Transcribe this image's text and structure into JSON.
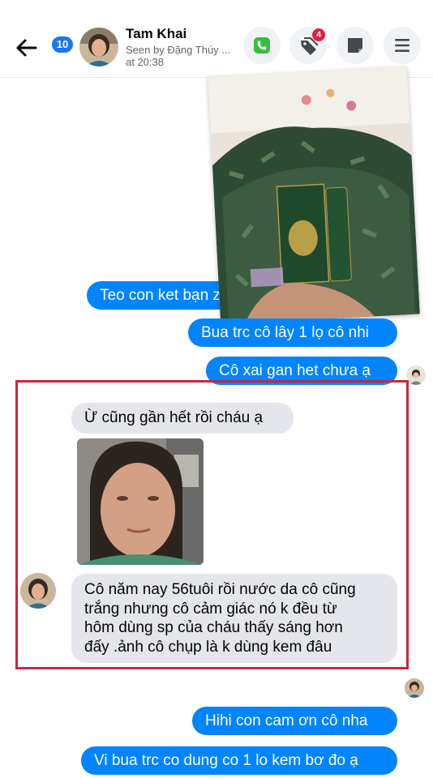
{
  "header": {
    "unread_count": "10",
    "contact_name": "Tam Khai",
    "seen_line1": "Seen by Đặng Thúy ...",
    "seen_line2": "at 20:38",
    "notification_count": "4"
  },
  "messages": [
    {
      "dir": "out",
      "text": "Teo con ket bạn zalo"
    },
    {
      "dir": "out",
      "text": "Bua trc cô lây 1 lọ cô nhi"
    },
    {
      "dir": "out",
      "text": "Cô xai gan het chưa ạ"
    },
    {
      "dir": "in",
      "text": "Ừ cũng gần hết rồi cháu ạ"
    },
    {
      "dir": "in",
      "lines": [
        "Cô năm nay 56tuôi rồi nước da cô cũng",
        "trắng nhưng cô cảm giác nó k đều từ",
        "hôm dùng sp của cháu thấy sáng hơn",
        "đấy .ảnh cô chụp là k dùng kem đâu"
      ]
    },
    {
      "dir": "out",
      "text": "Hihi con cam ơn cô nha"
    },
    {
      "dir": "out",
      "text": "Vi bua trc co dung co 1 lo kem bơ đo ạ"
    }
  ],
  "colors": {
    "outgoing_bubble": "#0084ff",
    "incoming_bubble": "#e4e6eb",
    "highlight_box": "#c9273c",
    "accent": "#1877f2"
  }
}
